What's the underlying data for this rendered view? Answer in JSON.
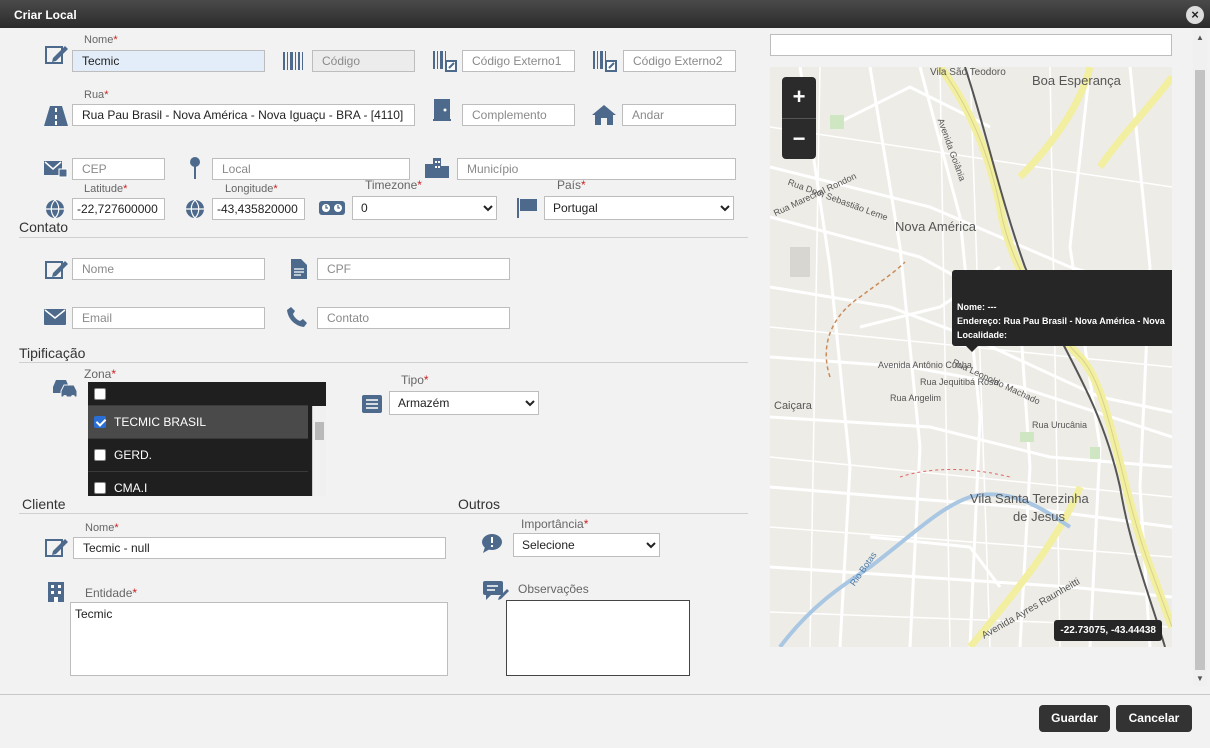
{
  "window": {
    "title": "Criar Local",
    "close_symbol": "×"
  },
  "identification": {
    "nome_label": "Nome",
    "nome_value": "Tecmic",
    "codigo_placeholder": "Código",
    "codigo_externo1_placeholder": "Código Externo1",
    "codigo_externo2_placeholder": "Código Externo2"
  },
  "address": {
    "rua_label": "Rua",
    "rua_value": "Rua Pau Brasil - Nova América - Nova Iguaçu - BRA - [4110]",
    "complemento_placeholder": "Complemento",
    "andar_placeholder": "Andar",
    "cep_placeholder": "CEP",
    "local_placeholder": "Local",
    "municipio_placeholder": "Município",
    "latitude_label": "Latitude",
    "latitude_value": "-22,727600000",
    "longitude_label": "Longitude",
    "longitude_value": "-43,435820000",
    "timezone_label": "Timezone",
    "timezone_value": "0",
    "pais_label": "País",
    "pais_value": "Portugal"
  },
  "contato": {
    "section_title": "Contato",
    "nome_placeholder": "Nome",
    "cpf_placeholder": "CPF",
    "email_placeholder": "Email",
    "contato_placeholder": "Contato"
  },
  "tipificacao": {
    "section_title": "Tipificação",
    "zona_label": "Zona",
    "zona_items": [
      {
        "label": "TECMIC BRASIL",
        "checked": true
      },
      {
        "label": "GERD.",
        "checked": false
      },
      {
        "label": "CMA.I",
        "checked": false
      }
    ],
    "tipo_label": "Tipo",
    "tipo_value": "Armazém"
  },
  "cliente": {
    "section_title": "Cliente",
    "nome_label": "Nome",
    "nome_value": "Tecmic - null",
    "entidade_label": "Entidade",
    "entidade_value": "Tecmic"
  },
  "outros": {
    "section_title": "Outros",
    "importancia_label": "Importância",
    "importancia_value": "Selecione",
    "observacoes_label": "Observações"
  },
  "map": {
    "zoom_in": "+",
    "zoom_out": "−",
    "popup": {
      "nome": "Nome: ---",
      "endereco": "Endereço: Rua Pau Brasil - Nova América - Nova",
      "localidade": "Localidade:"
    },
    "coordinates": "-22.73075, -43.44438",
    "labels": {
      "vila_sao_teodoro": "Vila São Teodoro",
      "boa_esperanca": "Boa Esperança",
      "nova_america": "Nova América",
      "caicara": "Caiçara",
      "vila_santa_terezinha": "Vila Santa Terezinha",
      "de_jesus": "de Jesus",
      "av_goiania": "Avenida Goiânia",
      "av_antonio_cunha": "Avenida Antônio Cunha",
      "rua_marechal_rondon": "Rua Marechal Rondon",
      "rua_leopoldo_machado": "Rua Leopoldo Machado",
      "rua_urucania": "Rua Urucânia",
      "rua_angelim": "Rua Angelim",
      "av_ayres_raunheitti": "Avenida Ayres Raunheitti",
      "rio_botas": "Rio Botas",
      "rua_dom_sebastiao_leme": "Rua Dom Sebastião Leme",
      "rua_jequitiba_rosa": "Rua Jequitibá Rosa"
    }
  },
  "footer": {
    "guardar": "Guardar",
    "cancelar": "Cancelar"
  },
  "colors": {
    "accent": "#333333",
    "required": "#cc2222",
    "filled_input": "#e3edf9"
  }
}
